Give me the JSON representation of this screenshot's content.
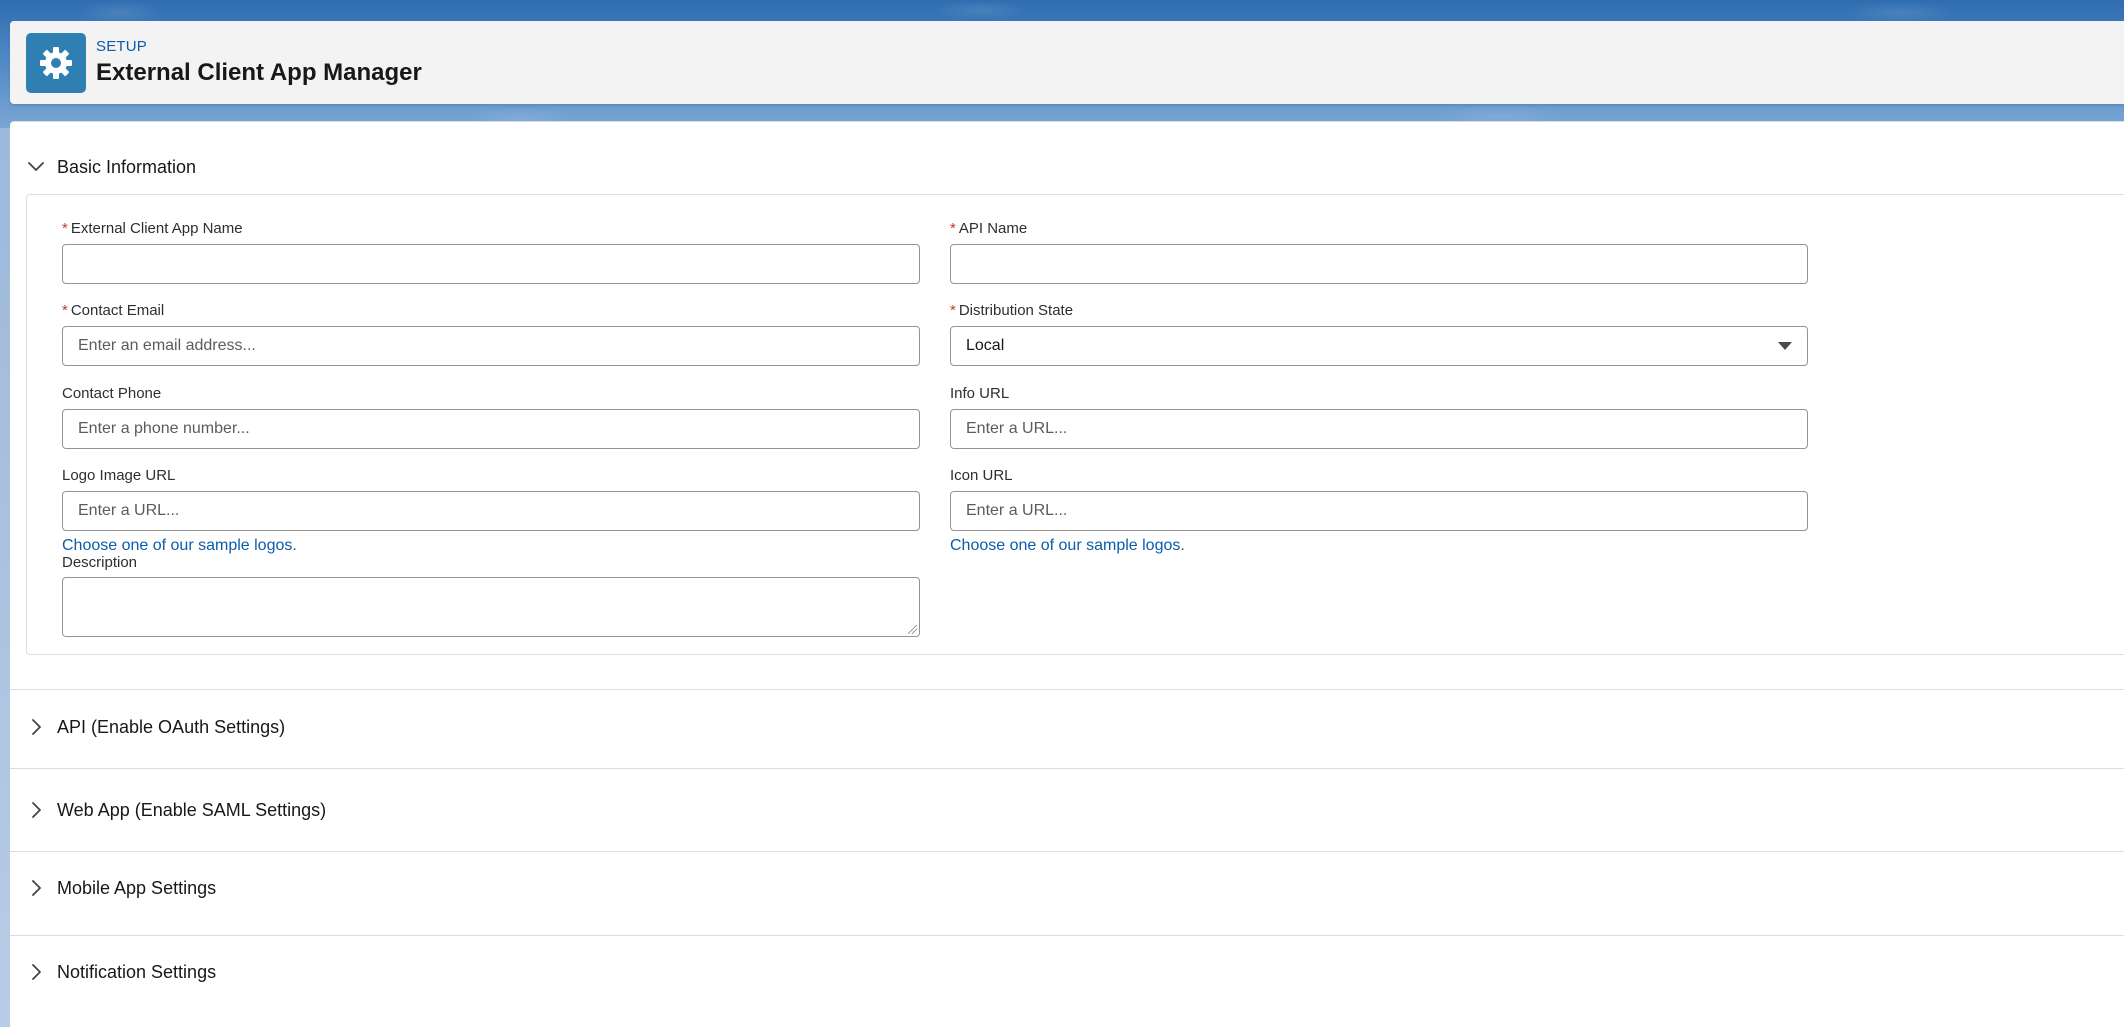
{
  "header": {
    "eyebrow": "SETUP",
    "title": "External Client App Manager",
    "icon": "gear-icon",
    "icon_bg": "#2f7fb2"
  },
  "sections": {
    "basic": {
      "title": "Basic Information",
      "expanded": true
    },
    "api": {
      "title": "API (Enable OAuth Settings)",
      "expanded": false
    },
    "webapp": {
      "title": "Web App (Enable SAML Settings)",
      "expanded": false
    },
    "mobile": {
      "title": "Mobile App Settings",
      "expanded": false
    },
    "notification": {
      "title": "Notification Settings",
      "expanded": false
    }
  },
  "form": {
    "app_name": {
      "label": "External Client App Name",
      "required": true,
      "value": ""
    },
    "api_name": {
      "label": "API Name",
      "required": true,
      "value": ""
    },
    "contact_email": {
      "label": "Contact Email",
      "required": true,
      "placeholder": "Enter an email address..."
    },
    "distribution_state": {
      "label": "Distribution State",
      "required": true,
      "value": "Local"
    },
    "contact_phone": {
      "label": "Contact Phone",
      "required": false,
      "placeholder": "Enter a phone number..."
    },
    "info_url": {
      "label": "Info URL",
      "required": false,
      "placeholder": "Enter a URL..."
    },
    "logo_url": {
      "label": "Logo Image URL",
      "required": false,
      "placeholder": "Enter a URL...",
      "link": "Choose one of our sample logos."
    },
    "icon_url": {
      "label": "Icon URL",
      "required": false,
      "placeholder": "Enter a URL...",
      "link": "Choose one of our sample logos."
    },
    "description": {
      "label": "Description",
      "required": false,
      "value": ""
    }
  },
  "colors": {
    "link": "#0b5cab",
    "required": "#c23934",
    "border": "#939393"
  }
}
